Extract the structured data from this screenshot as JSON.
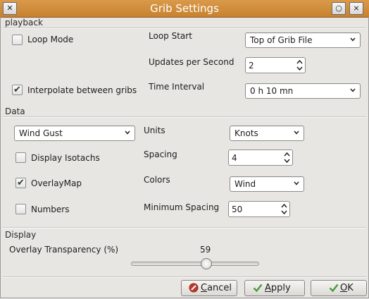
{
  "window": {
    "title": "Grib Settings",
    "close_glyph": "✕",
    "btn_circle": "○",
    "btn_close2": "⨯"
  },
  "playback": {
    "section": "playback",
    "loop_mode": {
      "label": "Loop Mode",
      "checked": false
    },
    "interpolate": {
      "label": "Interpolate between gribs",
      "checked": true
    },
    "loop_start": {
      "label": "Loop Start",
      "value": "Top of Grib File"
    },
    "updates_per_second": {
      "label": "Updates per Second",
      "value": "2"
    },
    "time_interval": {
      "label": "Time Interval",
      "value": "0 h 10 mn"
    }
  },
  "data": {
    "section": "Data",
    "data_select": "Wind Gust",
    "display_isotachs": {
      "label": "Display Isotachs",
      "checked": false
    },
    "overlay_map": {
      "label": "OverlayMap",
      "checked": true
    },
    "numbers": {
      "label": "Numbers",
      "checked": false
    },
    "units": {
      "label": "Units",
      "value": "Knots"
    },
    "spacing": {
      "label": "Spacing",
      "value": "4"
    },
    "colors": {
      "label": "Colors",
      "value": "Wind"
    },
    "minimum_spacing": {
      "label": "Minimum Spacing",
      "value": "50"
    }
  },
  "display": {
    "section": "Display",
    "overlay_label": "Overlay Transparency (%)",
    "overlay_value": "59",
    "overlay_level_fraction": 0.59
  },
  "buttons": {
    "cancel": {
      "first": "C",
      "rest": "ancel"
    },
    "apply": {
      "first": "A",
      "rest": "pply"
    },
    "ok": {
      "first": "O",
      "rest": "K"
    }
  },
  "colors": {
    "titlebar": "#cf8c3a",
    "cancel_icon": "#c0392b",
    "check_icon": "#4a9a3a"
  }
}
